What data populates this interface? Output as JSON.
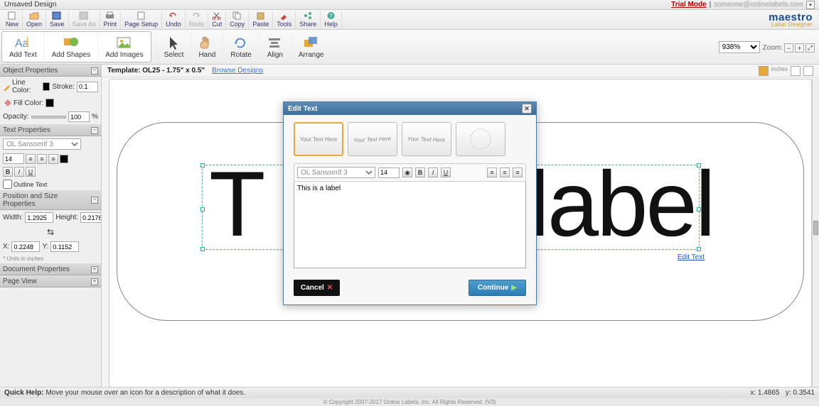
{
  "title": "Unsaved Design",
  "titlebar": {
    "trial": "Trial Mode",
    "sep": "|",
    "email": "someone@onlinelabels.com"
  },
  "brand": {
    "main": "maestro",
    "sub": "Label Designer"
  },
  "toolbar": {
    "new": "New",
    "open": "Open",
    "save": "Save",
    "saveas": "Save As",
    "print": "Print",
    "pagesetup": "Page Setup",
    "undo": "Undo",
    "redo": "Redo",
    "cut": "Cut",
    "copy": "Copy",
    "paste": "Paste",
    "tools": "Tools",
    "share": "Share",
    "help": "Help"
  },
  "ribbon": {
    "addtext": "Add Text",
    "addshapes": "Add Shapes",
    "addimages": "Add Images",
    "select": "Select",
    "hand": "Hand",
    "rotate": "Rotate",
    "align": "Align",
    "arrange": "Arrange",
    "zoomlabel": "Zoom:",
    "zoomval": "938%"
  },
  "canvas": {
    "template_prefix": "Template: ",
    "template": "OL25 - 1.75\" x 0.5\"",
    "browse": "Browse Designs",
    "bigtext1": "T",
    "bigtext2": "label",
    "editlink": "Edit Text",
    "inches": "inches"
  },
  "panels": {
    "obj": {
      "title": "Object Properties",
      "linecolor": "Line Color:",
      "stroke": "Stroke:",
      "strokeval": "0.1",
      "fillcolor": "Fill Color:",
      "opacity": "Opacity:",
      "opval": "100",
      "oppct": "%"
    },
    "text": {
      "title": "Text Properties",
      "font": "OL Sansserif 3",
      "size": "14",
      "outline": "Outline Text"
    },
    "pos": {
      "title": "Position and Size Properties",
      "wlabel": "Width:",
      "wval": "1.2925",
      "hlabel": "Height:",
      "hval": "0.2176",
      "xlabel": "X:",
      "xval": "0.2248",
      "ylabel": "Y:",
      "yval": "0.1152",
      "units": "* Units in inches"
    },
    "doc": {
      "title": "Document Properties"
    },
    "page": {
      "title": "Page View"
    }
  },
  "dialog": {
    "title": "Edit Text",
    "styleopt": "Your Text Here",
    "font": "OL Sansserif 3",
    "size": "14",
    "textval": "This is a label",
    "cancel": "Cancel",
    "continue": "Continue"
  },
  "status": {
    "help": "Quick Help:",
    "helptext": " Move your mouse over an icon for a description of what it does.",
    "x": "x: 1.4865",
    "y": "y: 0.3541"
  },
  "copyright": "© Copyright 2007-2017 Online Labels, Inc. All Rights Reserved. (V3)"
}
